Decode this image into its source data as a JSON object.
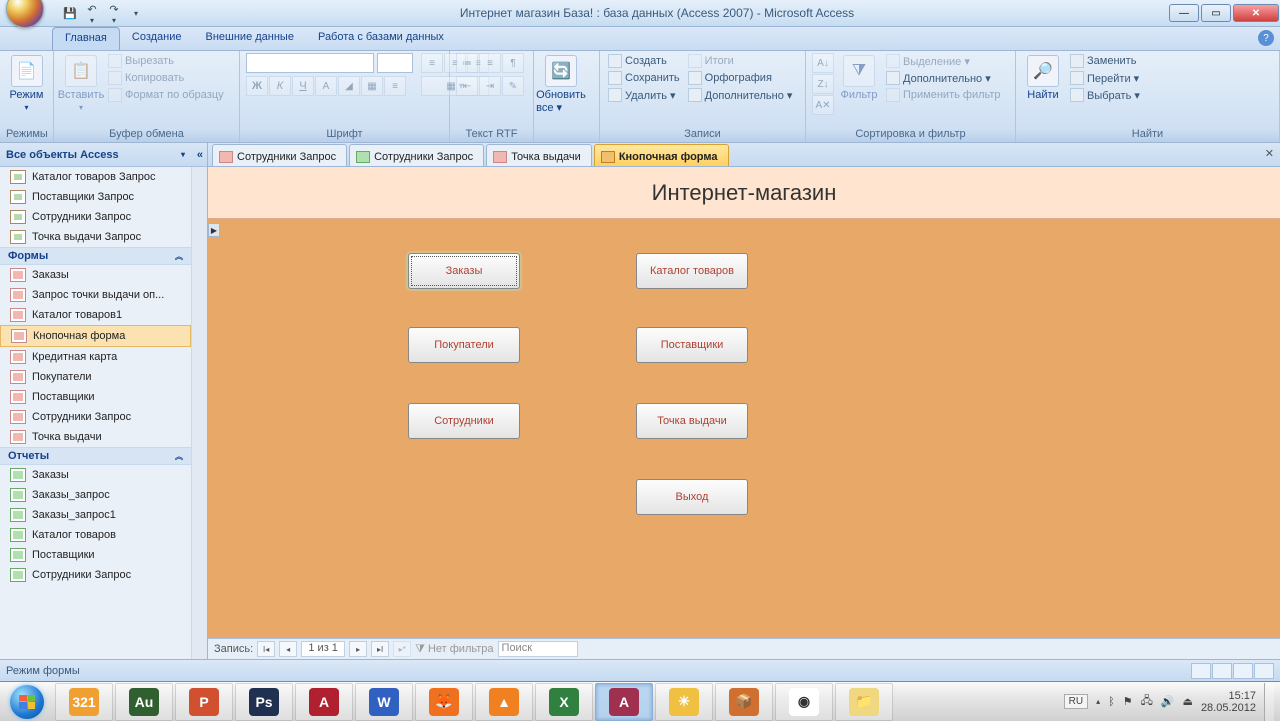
{
  "titlebar": {
    "title": "Интернет магазин База! : база данных (Access 2007) - Microsoft Access"
  },
  "menu": {
    "tabs": [
      "Главная",
      "Создание",
      "Внешние данные",
      "Работа с базами данных"
    ]
  },
  "ribbon": {
    "mode": {
      "label": "Режим",
      "group": "Режимы"
    },
    "clipboard": {
      "group": "Буфер обмена",
      "paste": "Вставить",
      "cut": "Вырезать",
      "copy": "Копировать",
      "fmt": "Формат по образцу"
    },
    "font": {
      "group": "Шрифт"
    },
    "rtf": {
      "group": "Текст RTF"
    },
    "refresh": {
      "label": "Обновить все ▾"
    },
    "records": {
      "group": "Записи",
      "create": "Создать",
      "save": "Сохранить",
      "delete": "Удалить ▾",
      "totals": "Итоги",
      "spell": "Орфография",
      "more": "Дополнительно ▾"
    },
    "sortf": {
      "group": "Сортировка и фильтр",
      "filter": "Фильтр",
      "sel": "Выделение ▾",
      "adv": "Дополнительно ▾",
      "apply": "Применить фильтр"
    },
    "find": {
      "group": "Найти",
      "find": "Найти",
      "replace": "Заменить",
      "goto": "Перейти ▾",
      "select": "Выбрать ▾"
    }
  },
  "nav": {
    "title": "Все объекты Access",
    "queries": [
      "Каталог товаров Запрос",
      "Поставщики Запрос",
      "Сотрудники Запрос",
      "Точка выдачи Запрос"
    ],
    "cat_forms": "Формы",
    "forms": [
      "Заказы",
      "Запрос точки выдачи оп...",
      "Каталог товаров1",
      "Кнопочная форма",
      "Кредитная карта",
      "Покупатели",
      "Поставщики",
      "Сотрудники Запрос",
      "Точка выдачи"
    ],
    "cat_reports": "Отчеты",
    "reports": [
      "Заказы",
      "Заказы_запрос",
      "Заказы_запрос1",
      "Каталог товаров",
      "Поставщики",
      "Сотрудники Запрос"
    ]
  },
  "doctabs": {
    "t1": "Сотрудники Запрос",
    "t2": "Сотрудники Запрос",
    "t3": "Точка выдачи",
    "t4": "Кнопочная форма"
  },
  "form": {
    "title": "Интернет-магазин",
    "b1": "Заказы",
    "b2": "Каталог товаров",
    "b3": "Покупатели",
    "b4": "Поставщики",
    "b5": "Сотрудники",
    "b6": "Точка выдачи",
    "b7": "Выход"
  },
  "recnav": {
    "label": "Запись:",
    "pos": "1 из 1",
    "nofilter": "Нет фильтра",
    "search": "Поиск"
  },
  "status": {
    "mode": "Режим формы"
  },
  "tray": {
    "lang": "RU",
    "time": "15:17",
    "date": "28.05.2012"
  }
}
